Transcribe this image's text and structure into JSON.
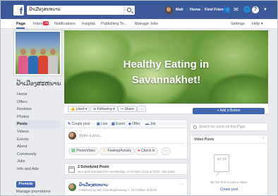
{
  "topbar": {
    "search_value": "ຟ້າເມືອງສະຫນານ",
    "user_name": "Mali",
    "home_label": "Home",
    "find_friends_label": "Find Friends",
    "icons": [
      "friends-icon",
      "messages-icon",
      "notifications-icon",
      "help-icon",
      "dropdown-icon"
    ],
    "color": "#3b5998"
  },
  "tabs": {
    "page": "Page",
    "inbox": "Inbox",
    "inbox_badge": "16",
    "notifications": "Notifications",
    "insights": "Insights",
    "publishing_tools": "Publishing To...",
    "manage_jobs": "Manage Jobs",
    "settings": "Settings",
    "help": "Help ▾"
  },
  "page": {
    "name": "ຟ້າເມືອງສະຫນານ",
    "cover_line1": "Healthy Eating in",
    "cover_line2": "Savannakhet!"
  },
  "sidebar": {
    "items": [
      {
        "label": "Home"
      },
      {
        "label": "Offers"
      },
      {
        "label": "Reviews"
      },
      {
        "label": "Photos"
      },
      {
        "label": "Posts"
      },
      {
        "label": "Videos"
      },
      {
        "label": "Events"
      },
      {
        "label": "About"
      },
      {
        "label": "Community"
      },
      {
        "label": "Jobs"
      },
      {
        "label": "Info and Ads"
      }
    ],
    "promote": "Promote",
    "manage_promotions": "Manage promotions"
  },
  "cover_actions": {
    "liked": "Liked ▾",
    "following": "Following ▾",
    "share": "Share",
    "more": "···",
    "add_button": "+ Add a Button"
  },
  "composer": {
    "tabs": [
      "Create post",
      "Live",
      "Event",
      "Offer",
      "Job"
    ],
    "placeholder": "Write a post...",
    "actions": [
      "Photo/Video",
      "Feeling/Activity",
      "Check in"
    ],
    "more": "···"
  },
  "scheduled": {
    "title": "3 Scheduled Posts",
    "subtitle": "Next post scheduled for Wednesday, 24 October 2018 at 15:00. See posts."
  },
  "post": {
    "name": "ຟ້າເມືອງສະຫນານ",
    "meta": "Published by Nith Chanthaphaiwong ?· 23 October at 00:04 ·",
    "more": "···"
  },
  "right": {
    "search_placeholder": "Search for posts on this Page",
    "videos_title": "Video Posts",
    "videos_more": "›",
    "videos_empty": "Be the first to post a video",
    "create_post": "Create post"
  }
}
